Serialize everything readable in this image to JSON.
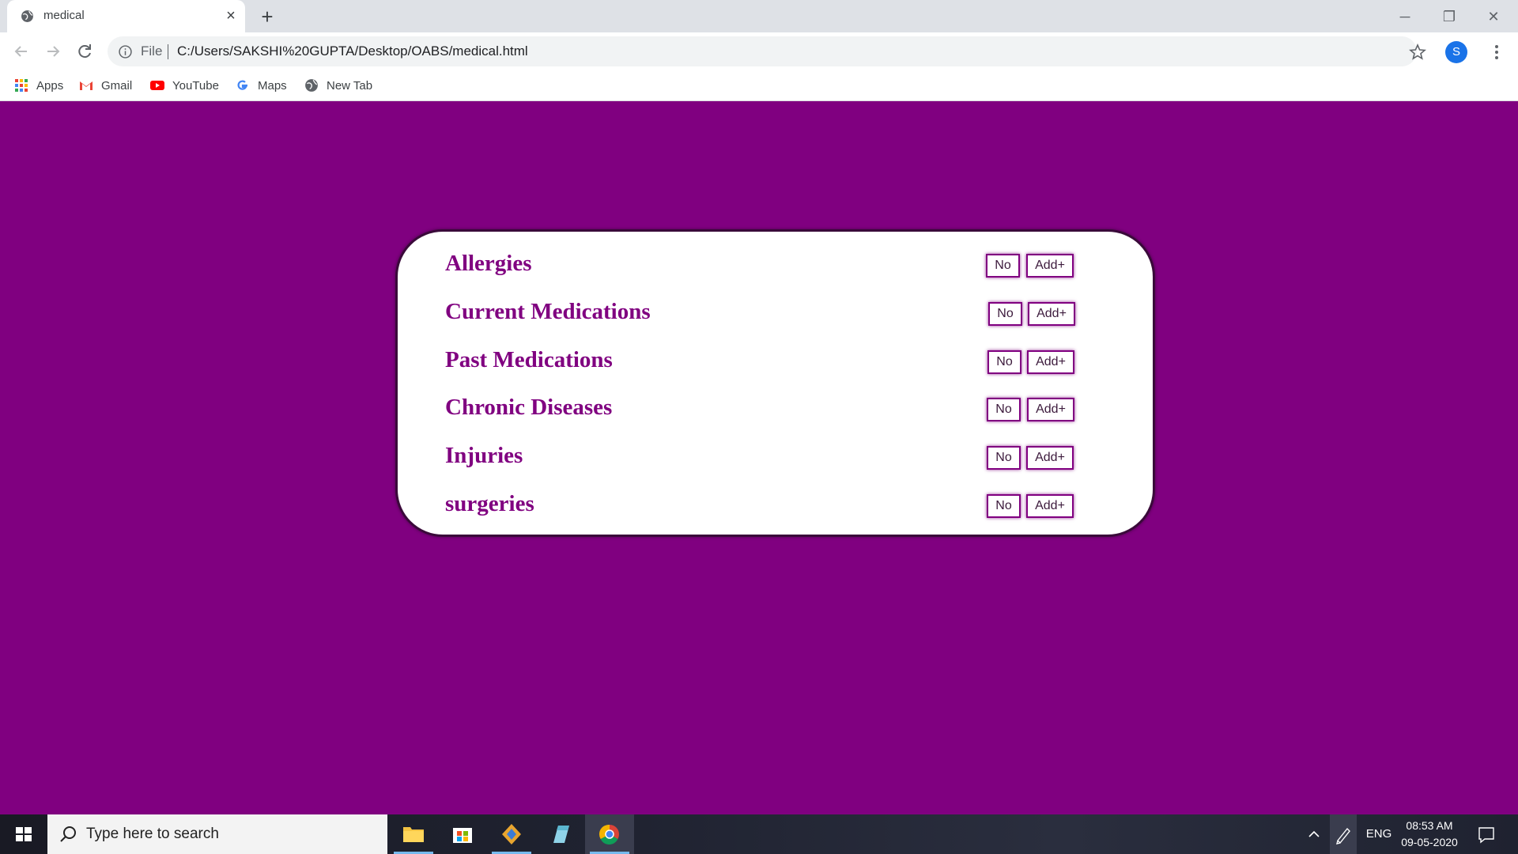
{
  "browser": {
    "tab_title": "medical",
    "url_scheme_label": "File",
    "url": "C:/Users/SAKSHI%20GUPTA/Desktop/OABS/medical.html",
    "profile_initial": "S",
    "bookmarks": [
      {
        "label": "Apps",
        "icon": "apps-grid-icon"
      },
      {
        "label": "Gmail",
        "icon": "gmail-icon"
      },
      {
        "label": "YouTube",
        "icon": "youtube-icon"
      },
      {
        "label": "Maps",
        "icon": "google-icon"
      },
      {
        "label": "New Tab",
        "icon": "globe-icon"
      }
    ]
  },
  "page": {
    "background_color": "#800080",
    "rows": [
      {
        "label": "Allergies",
        "no_label": "No",
        "add_label": "Add+"
      },
      {
        "label": "Current Medications",
        "no_label": "No",
        "add_label": "Add+"
      },
      {
        "label": "Past Medications",
        "no_label": "No",
        "add_label": "Add+"
      },
      {
        "label": "Chronic Diseases",
        "no_label": "No",
        "add_label": "Add+"
      },
      {
        "label": "Injuries",
        "no_label": "No",
        "add_label": "Add+"
      },
      {
        "label": "surgeries",
        "no_label": "No",
        "add_label": "Add+"
      }
    ]
  },
  "taskbar": {
    "search_placeholder": "Type here to search",
    "language": "ENG",
    "time": "08:53 AM",
    "date": "09-05-2020"
  }
}
